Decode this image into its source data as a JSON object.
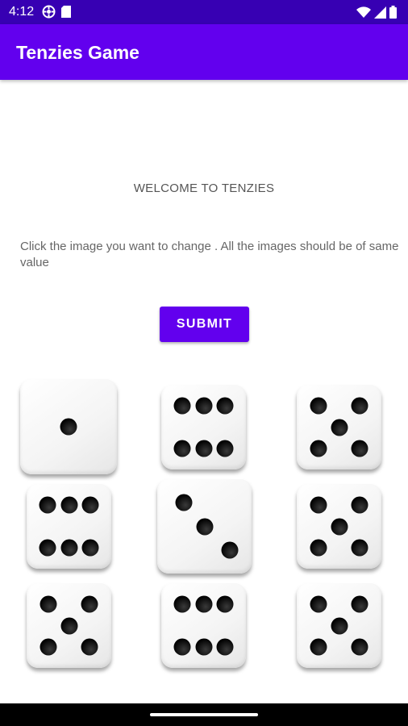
{
  "status_bar": {
    "time": "4:12",
    "left_icons": [
      "vpn-icon",
      "sd-card-icon"
    ],
    "right_icons": [
      "wifi-icon",
      "cell-signal-icon",
      "battery-icon"
    ]
  },
  "app_bar": {
    "title": "Tenzies Game",
    "color": "#6200ee"
  },
  "main": {
    "welcome": "WELCOME TO TENZIES",
    "instructions": "Click the image you want to change . All the images should be of same value",
    "submit_label": "SUBMIT"
  },
  "dice": [
    {
      "value": 1
    },
    {
      "value": 6
    },
    {
      "value": 5
    },
    {
      "value": 6
    },
    {
      "value": 3
    },
    {
      "value": 5
    },
    {
      "value": 5
    },
    {
      "value": 6
    },
    {
      "value": 5
    }
  ],
  "colors": {
    "status_bar": "#3700b3",
    "primary": "#6200ee"
  }
}
